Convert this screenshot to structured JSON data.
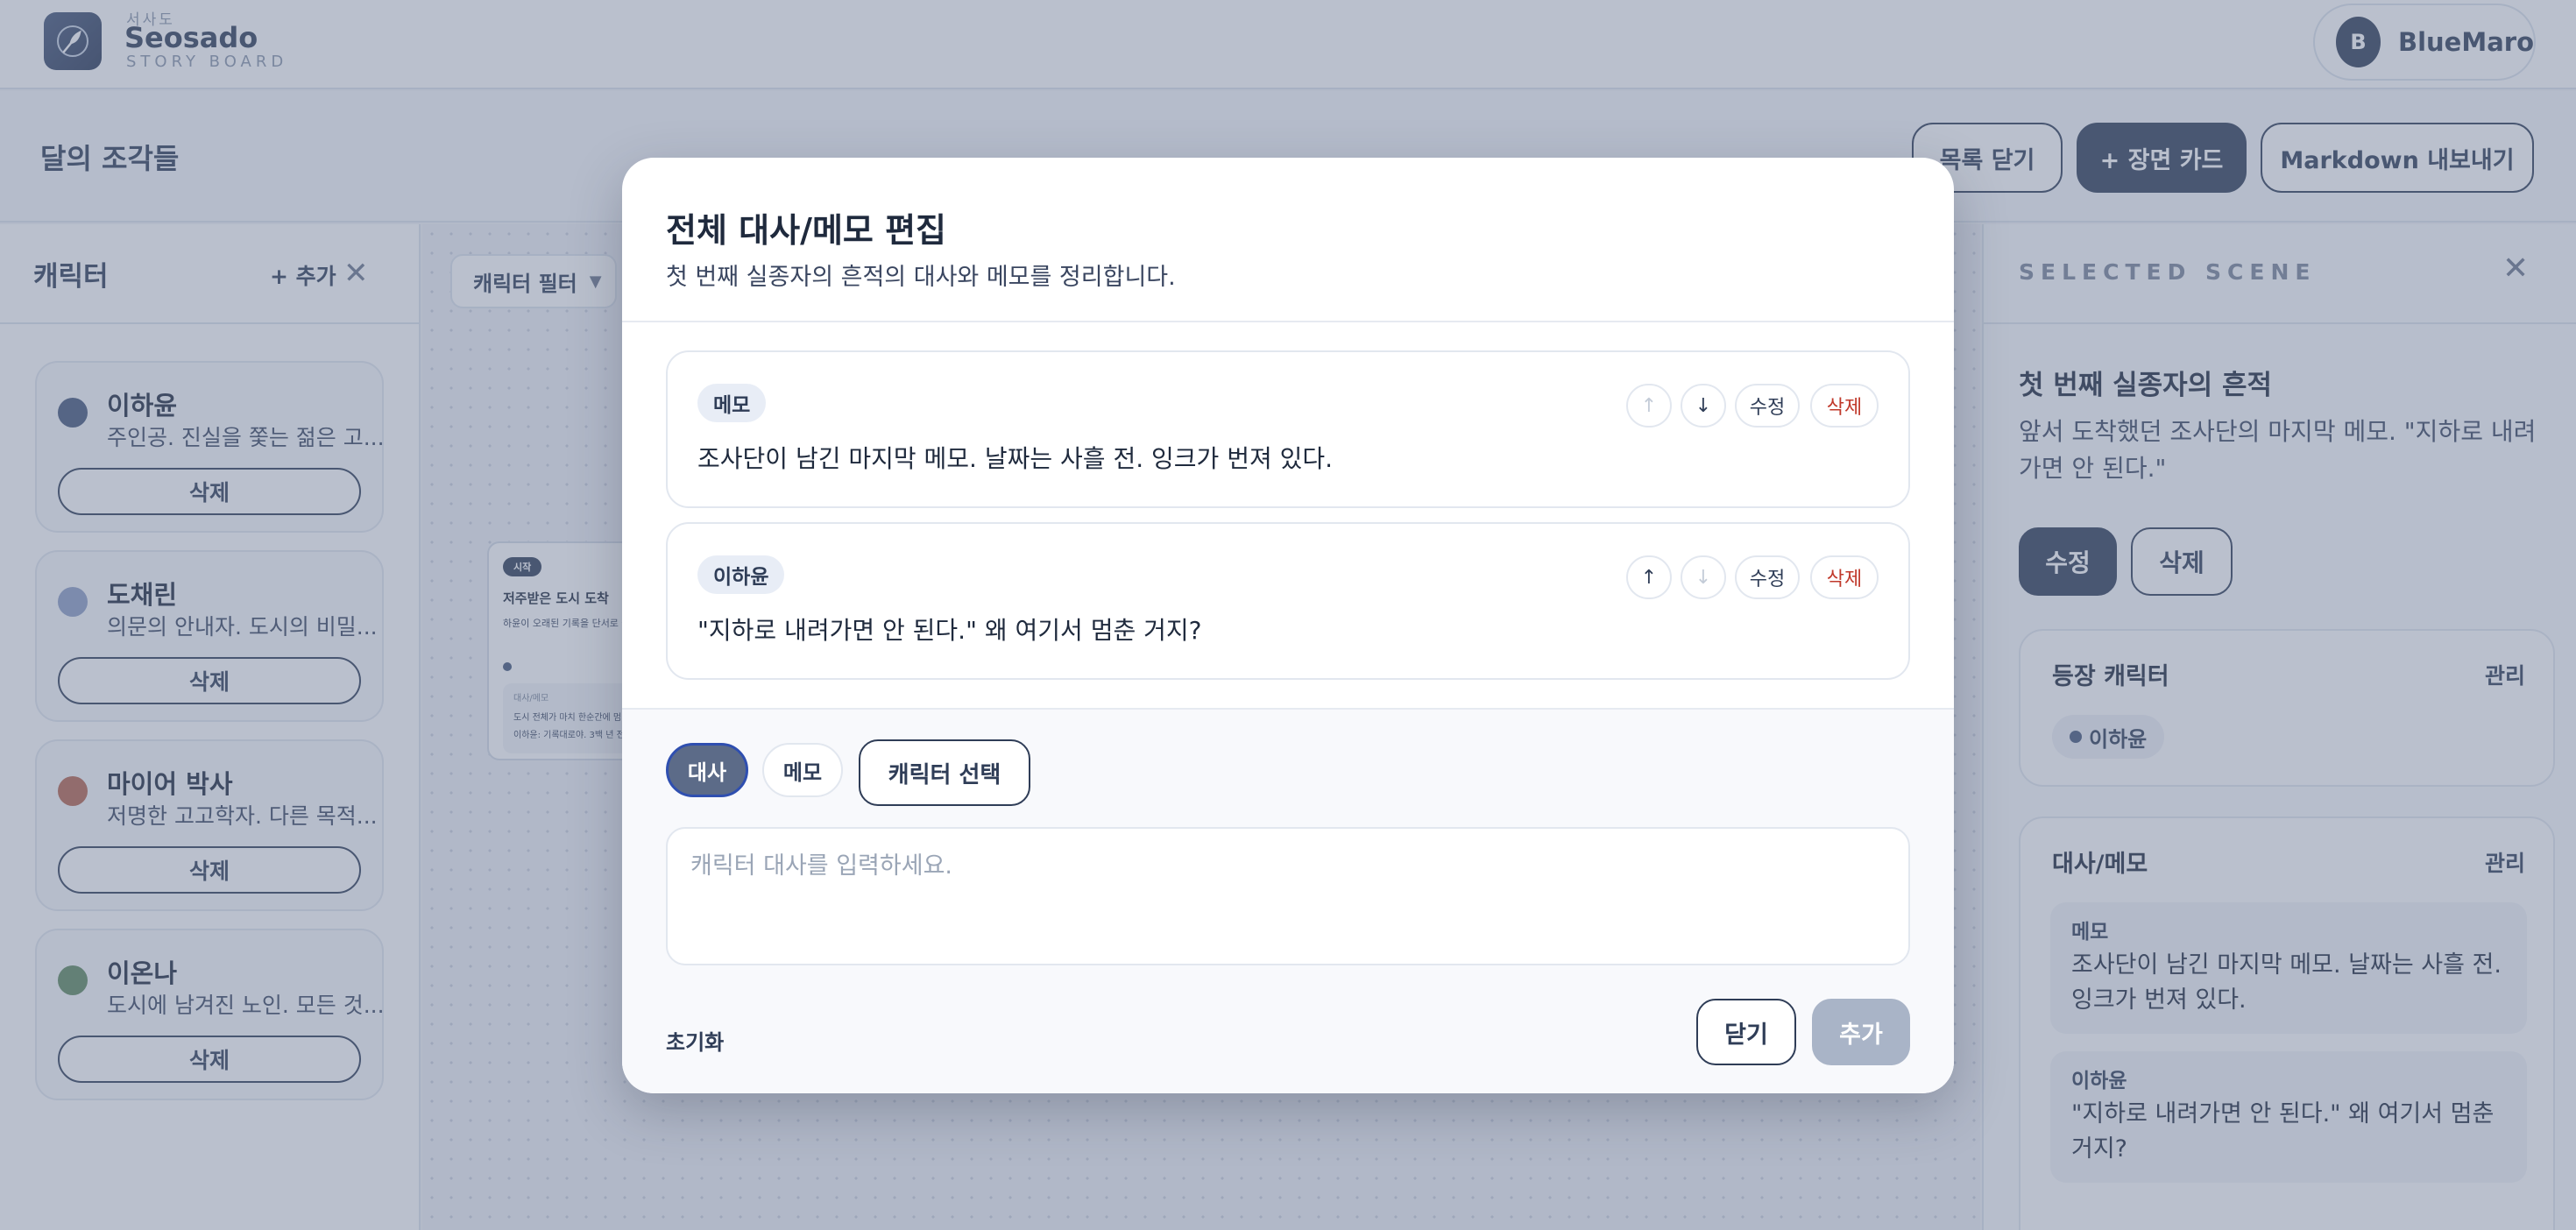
{
  "app": {
    "brand_kr": "서사도",
    "brand_name": "Seosado",
    "brand_sub": "STORY BOARD",
    "user_initial": "B",
    "user_name": "BlueMaro"
  },
  "toolbar": {
    "title": "달의 조각들",
    "close_list": "목록 닫기",
    "add_scene": "+ 장면 카드",
    "export_md": "Markdown 내보내기"
  },
  "characters_panel": {
    "title": "캐릭터",
    "add": "+ 추가",
    "delete_label": "삭제",
    "items": [
      {
        "name": "이하윤",
        "desc": "주인공. 진실을 쫓는 젊은 고...",
        "color": "#45577a"
      },
      {
        "name": "도채린",
        "desc": "의문의 안내자. 도시의 비밀...",
        "color": "#8c9ec4"
      },
      {
        "name": "마이어 박사",
        "desc": "저명한 고고학자. 다른 목적...",
        "color": "#b5654f"
      },
      {
        "name": "이온나",
        "desc": "도시에 남겨진 노인. 모든 것...",
        "color": "#5e8a5e"
      }
    ]
  },
  "canvas": {
    "filter": "캐릭터 필터",
    "scene_card": {
      "badge": "시작",
      "title": "저주받은 도시 도착",
      "text": "하윤이 오래된 기록을 단서로 불길한 침묵만이 가득하다.",
      "box_label": "대사/메모",
      "box_line1": "도시 전체가 마치 한순간에 멈",
      "box_line2": "이하윤: 기록대로야. 3백 년 전"
    }
  },
  "right_panel": {
    "label": "SELECTED SCENE",
    "scene_title": "첫 번째 실종자의 흔적",
    "scene_desc": "앞서 도착했던 조사단의 마지막 메모. \"지하로 내려가면 안 된다.\"",
    "edit": "수정",
    "delete": "삭제",
    "characters_title": "등장 캐릭터",
    "characters_manage": "관리",
    "character_chip": "이하윤",
    "dialogue_title": "대사/메모",
    "dialogue_manage": "관리",
    "items": [
      {
        "label": "메모",
        "text": "조사단이 남긴 마지막 메모. 날짜는 사흘 전. 잉크가 번져 있다."
      },
      {
        "label": "이하윤",
        "text": "\"지하로 내려가면 안 된다.\" 왜 여기서 멈춘 거지?"
      }
    ]
  },
  "modal": {
    "title": "전체 대사/메모 편집",
    "subtitle": "첫 번째 실종자의 흔적의 대사와 메모를 정리합니다.",
    "edit_label": "수정",
    "delete_label": "삭제",
    "entries": [
      {
        "type": "메모",
        "text": "조사단이 남긴 마지막 메모. 날짜는 사흘 전. 잉크가 번져 있다."
      },
      {
        "type": "이하윤",
        "text": "\"지하로 내려가면 안 된다.\" 왜 여기서 멈춘 거지?"
      }
    ],
    "tab_dialogue": "대사",
    "tab_memo": "메모",
    "character_select": "캐릭터 선택",
    "input_placeholder": "캐릭터 대사를 입력하세요.",
    "reset": "초기화",
    "close": "닫기",
    "add": "추가"
  }
}
